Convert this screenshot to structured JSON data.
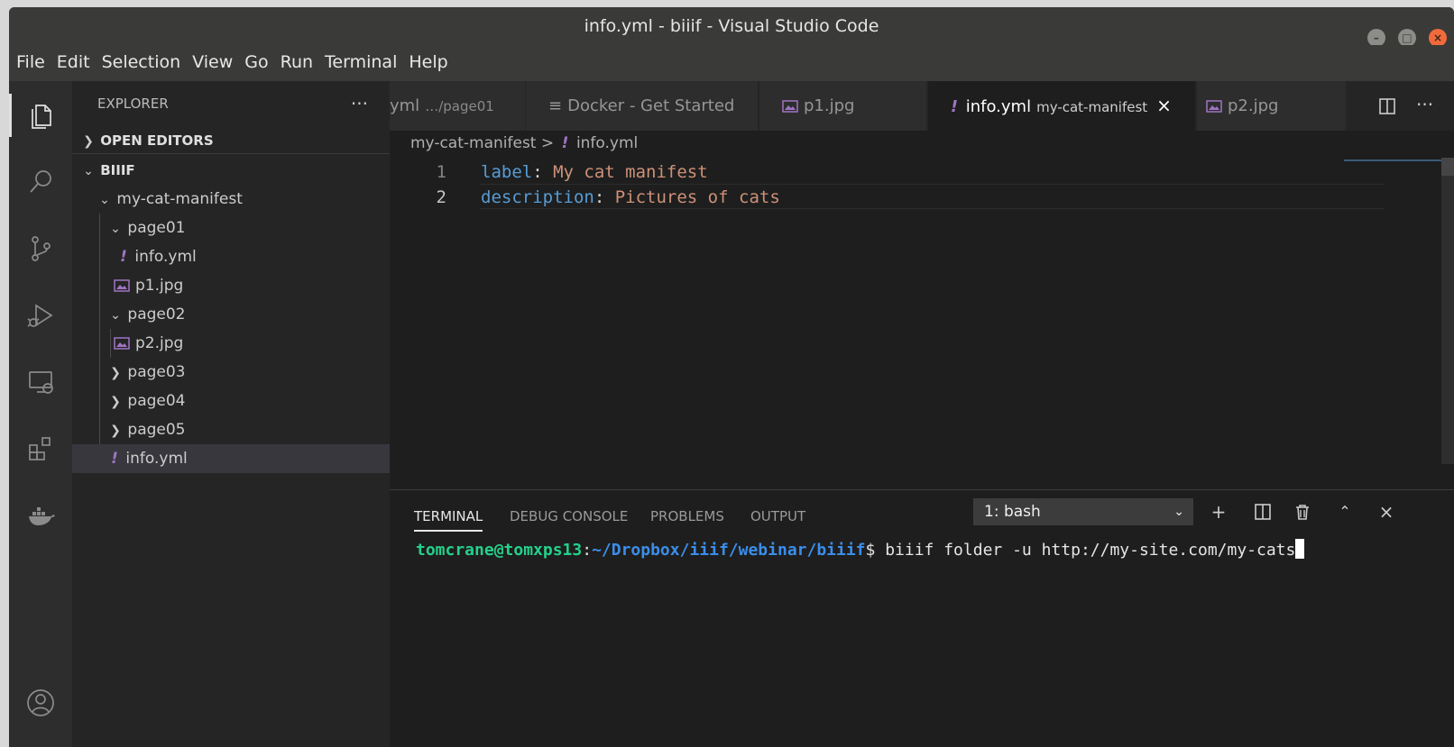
{
  "window": {
    "title": "info.yml - biiif - Visual Studio Code"
  },
  "menu": [
    "File",
    "Edit",
    "Selection",
    "View",
    "Go",
    "Run",
    "Terminal",
    "Help"
  ],
  "sidebar": {
    "title": "EXPLORER",
    "more": "···",
    "open_editors": "OPEN EDITORS",
    "workspace": "BIIIF",
    "tree": [
      {
        "label": "my-cat-manifest",
        "type": "folder-open"
      },
      {
        "label": "page01",
        "type": "folder-open"
      },
      {
        "label": "info.yml",
        "type": "yml"
      },
      {
        "label": "p1.jpg",
        "type": "image"
      },
      {
        "label": "page02",
        "type": "folder-open"
      },
      {
        "label": "p2.jpg",
        "type": "image"
      },
      {
        "label": "page03",
        "type": "folder-closed"
      },
      {
        "label": "page04",
        "type": "folder-closed"
      },
      {
        "label": "page05",
        "type": "folder-closed"
      },
      {
        "label": "info.yml",
        "type": "yml",
        "selected": true
      }
    ]
  },
  "tabs": [
    {
      "label": "yml",
      "desc": "…/page01"
    },
    {
      "label": "Docker - Get Started",
      "desc": ""
    },
    {
      "label": "p1.jpg",
      "desc": ""
    },
    {
      "label": "info.yml",
      "desc": "my-cat-manifest",
      "active": true
    },
    {
      "label": "p2.jpg",
      "desc": ""
    }
  ],
  "tab_actions": {
    "split": "split-editor-icon",
    "more": "···"
  },
  "breadcrumb": {
    "folder": "my-cat-manifest",
    "separator": ">",
    "file": "info.yml"
  },
  "editor": {
    "lines": [
      {
        "num": "1",
        "key": "label",
        "sep": ": ",
        "value": "My cat manifest"
      },
      {
        "num": "2",
        "key": "description",
        "sep": ": ",
        "value": "Pictures of cats"
      }
    ]
  },
  "panel": {
    "tabs": [
      "TERMINAL",
      "DEBUG CONSOLE",
      "PROBLEMS",
      "OUTPUT"
    ],
    "active_tab": "TERMINAL",
    "terminal_select": "1: bash",
    "terminal": {
      "user": "tomcrane@tomxps13",
      "colon": ":",
      "path": "~/Dropbox/iiif/webinar/biiif",
      "prompt": "$ ",
      "command": "biiif folder -u http://my-site.com/my-cats"
    }
  },
  "colors": {
    "accent_yml": "#a074c4",
    "terminal_user": "#23d18b",
    "terminal_path": "#3b8eea",
    "yaml_key": "#569cd6",
    "yaml_value": "#ce9178"
  }
}
